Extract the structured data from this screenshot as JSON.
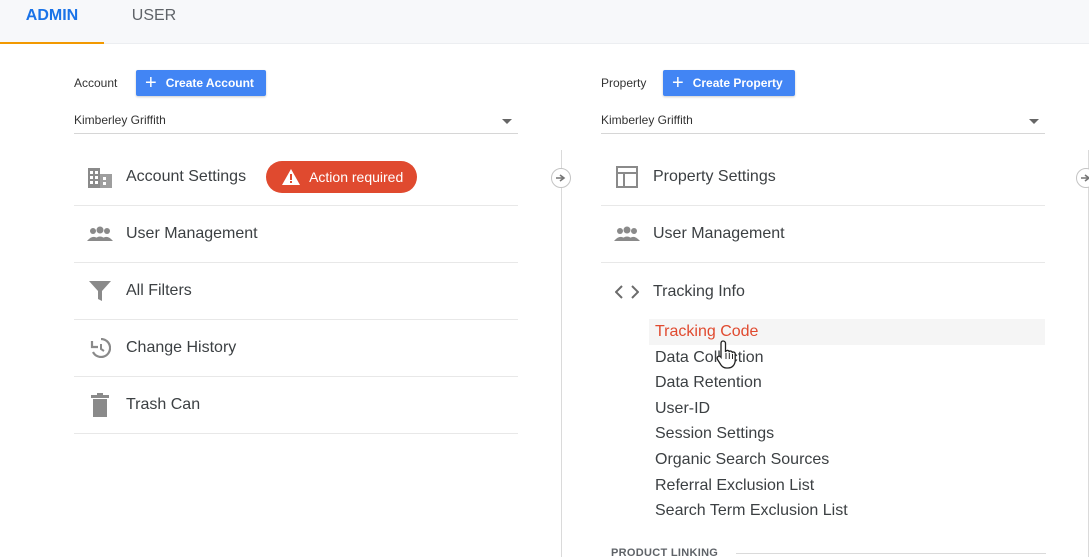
{
  "tabs": {
    "admin": "ADMIN",
    "user": "USER"
  },
  "account": {
    "label": "Account",
    "create_label": "Create Account",
    "selected": "Kimberley Griffith",
    "items": [
      {
        "label": "Account Settings",
        "icon": "building-icon"
      },
      {
        "label": "User Management",
        "icon": "people-icon"
      },
      {
        "label": "All Filters",
        "icon": "filter-icon"
      },
      {
        "label": "Change History",
        "icon": "history-icon"
      },
      {
        "label": "Trash Can",
        "icon": "trash-icon"
      }
    ],
    "badge": "Action required"
  },
  "property": {
    "label": "Property",
    "create_label": "Create Property",
    "selected": "Kimberley Griffith",
    "items": [
      {
        "label": "Property Settings",
        "icon": "layout-icon"
      },
      {
        "label": "User Management",
        "icon": "people-icon"
      },
      {
        "label": "Tracking Info",
        "icon": "code-icon"
      }
    ],
    "tracking_sub": [
      "Tracking Code",
      "Data Collection",
      "Data Retention",
      "User-ID",
      "Session Settings",
      "Organic Search Sources",
      "Referral Exclusion List",
      "Search Term Exclusion List"
    ],
    "section": "PRODUCT LINKING"
  },
  "colors": {
    "accent": "#1a73e8",
    "button": "#4285f4",
    "alert": "#e04a2f",
    "tab_underline": "#f29900"
  }
}
